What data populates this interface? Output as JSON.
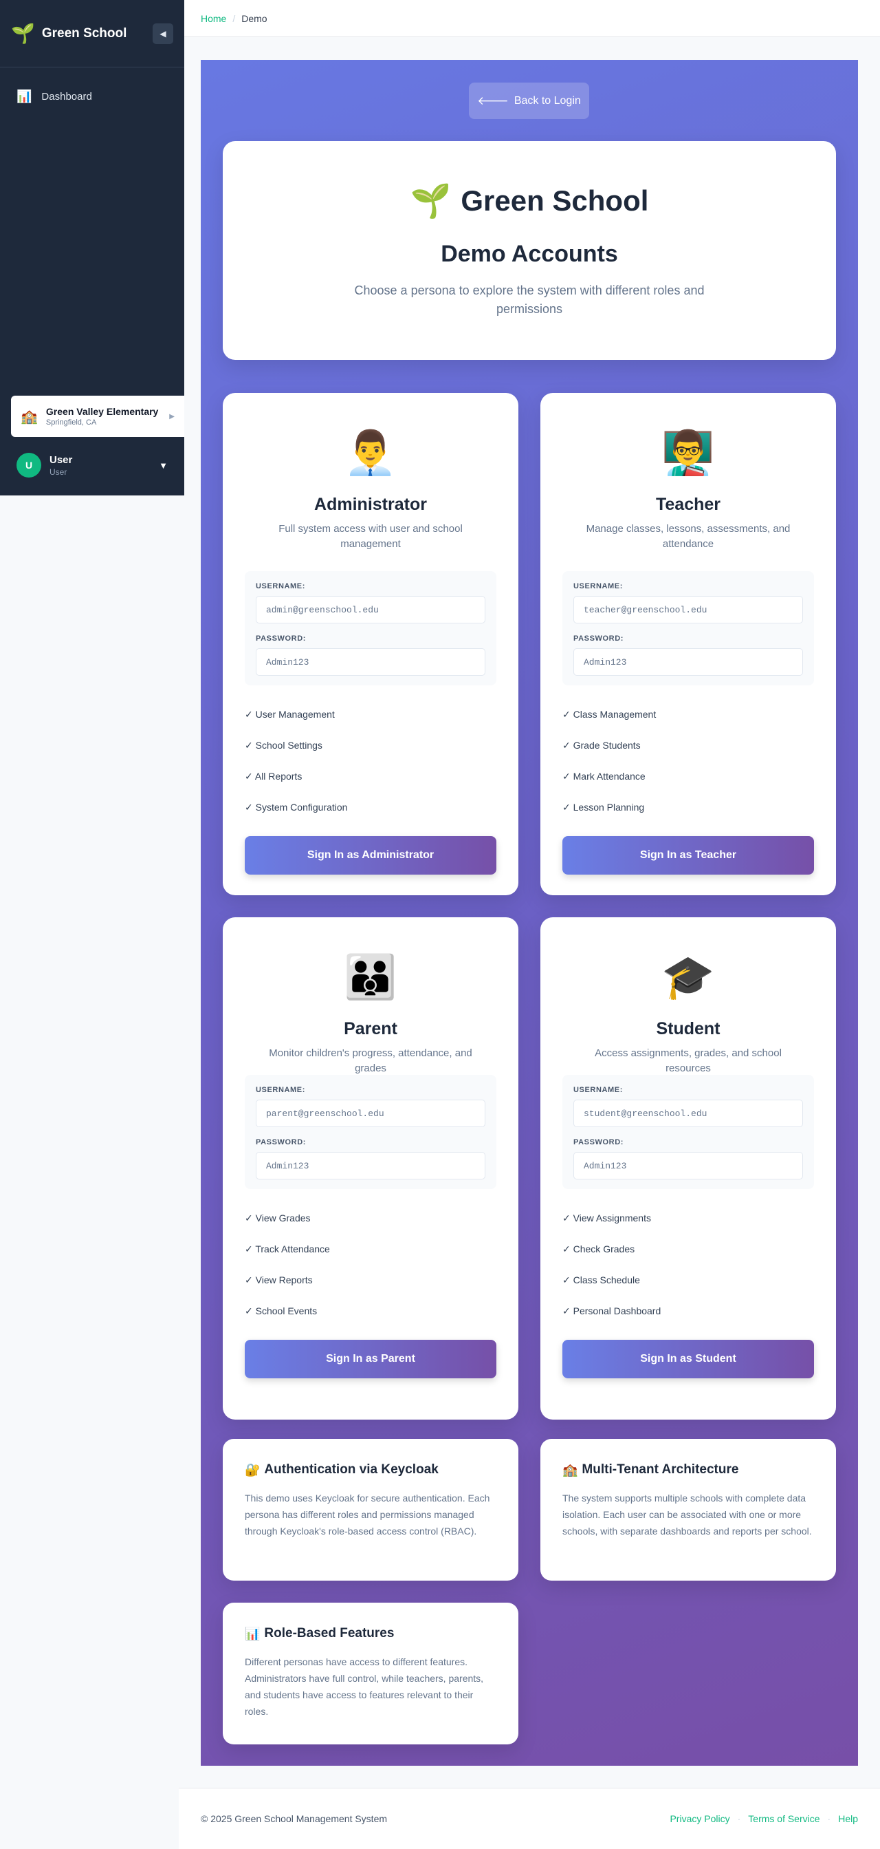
{
  "sidebar": {
    "brand": "Green School",
    "brand_icon": "🌱",
    "collapse_icon": "◀",
    "nav": [
      {
        "label": "Dashboard",
        "icon": "📊"
      }
    ],
    "school": {
      "name": "Green Valley Elementary",
      "location": "Springfield, CA",
      "icon": "🏫",
      "arrow": "▶"
    },
    "user": {
      "initial": "U",
      "name": "User",
      "role": "User",
      "caret": "▼"
    }
  },
  "breadcrumb": {
    "home": "Home",
    "sep": "/",
    "current": "Demo"
  },
  "back_button": {
    "icon": "🡐",
    "label": "Back to Login"
  },
  "intro": {
    "icon": "🌱",
    "brand": "Green School",
    "title": "Demo Accounts",
    "subtitle": "Choose a persona to explore the system with different roles and permissions"
  },
  "personas": [
    {
      "emoji": "👨‍💼",
      "title": "Administrator",
      "description": "Full system access with user and school management",
      "username_label": "USERNAME:",
      "username": "admin@greenschool.edu",
      "password_label": "PASSWORD:",
      "password": "Admin123",
      "features": [
        "✓ User Management",
        "✓ School Settings",
        "✓ All Reports",
        "✓ System Configuration"
      ],
      "button": "Sign In as Administrator"
    },
    {
      "emoji": "👨‍🏫",
      "title": "Teacher",
      "description": "Manage classes, lessons, assessments, and attendance",
      "username_label": "USERNAME:",
      "username": "teacher@greenschool.edu",
      "password_label": "PASSWORD:",
      "password": "Admin123",
      "features": [
        "✓ Class Management",
        "✓ Grade Students",
        "✓ Mark Attendance",
        "✓ Lesson Planning"
      ],
      "button": "Sign In as Teacher"
    },
    {
      "emoji": "👪",
      "title": "Parent",
      "description": "Monitor children's progress, attendance, and grades",
      "username_label": "USERNAME:",
      "username": "parent@greenschool.edu",
      "password_label": "PASSWORD:",
      "password": "Admin123",
      "features": [
        "✓ View Grades",
        "✓ Track Attendance",
        "✓ View Reports",
        "✓ School Events"
      ],
      "button": "Sign In as Parent"
    },
    {
      "emoji": "🎓",
      "title": "Student",
      "description": "Access assignments, grades, and school resources",
      "username_label": "USERNAME:",
      "username": "student@greenschool.edu",
      "password_label": "PASSWORD:",
      "password": "Admin123",
      "features": [
        "✓ View Assignments",
        "✓ Check Grades",
        "✓ Class Schedule",
        "✓ Personal Dashboard"
      ],
      "button": "Sign In as Student"
    }
  ],
  "info_cards": [
    {
      "icon": "🔐",
      "title": "Authentication via Keycloak",
      "text": "This demo uses Keycloak for secure authentication. Each persona has different roles and permissions managed through Keycloak's role-based access control (RBAC)."
    },
    {
      "icon": "🏫",
      "title": "Multi-Tenant Architecture",
      "text": "The system supports multiple schools with complete data isolation. Each user can be associated with one or more schools, with separate dashboards and reports per school."
    },
    {
      "icon": "📊",
      "title": "Role-Based Features",
      "text": "Different personas have access to different features. Administrators have full control, while teachers, parents, and students have access to features relevant to their roles."
    }
  ],
  "footer": {
    "copyright": "© 2025 Green School Management System",
    "links": [
      "Privacy Policy",
      "Terms of Service",
      "Help"
    ],
    "sep": "·"
  },
  "colors": {
    "accent": "#10b981",
    "sidebar": "#1e293b",
    "gradient_start": "#6878e2",
    "gradient_end": "#774fa8"
  }
}
